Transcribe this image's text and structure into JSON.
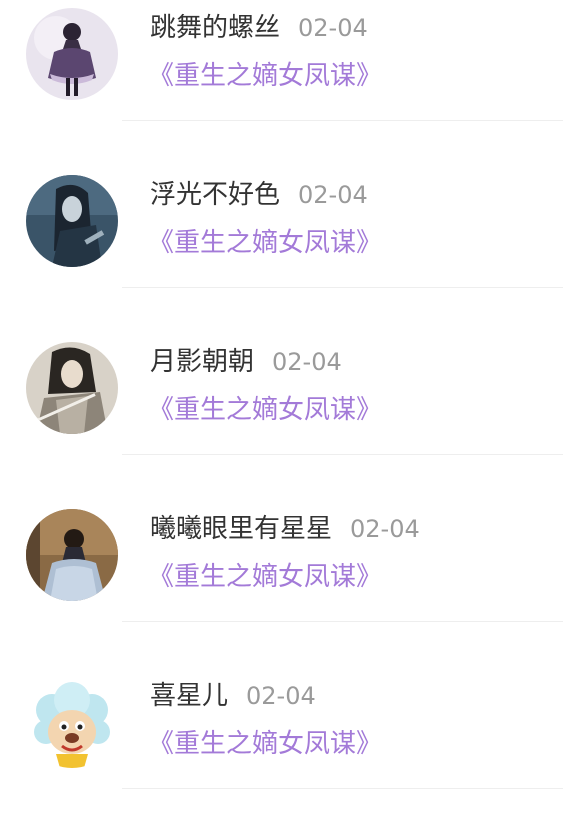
{
  "comments": [
    {
      "user": "跳舞的螺丝",
      "date": "02-04",
      "book": "《重生之嫡女凤谋》",
      "avatar_icon": "gothic-lolita-girl-avatar"
    },
    {
      "user": "浮光不好色",
      "date": "02-04",
      "book": "《重生之嫡女凤谋》",
      "avatar_icon": "dark-haired-character-avatar"
    },
    {
      "user": "月影朝朝",
      "date": "02-04",
      "book": "《重生之嫡女凤谋》",
      "avatar_icon": "ancient-style-swordsman-avatar"
    },
    {
      "user": "曦曦眼里有星星",
      "date": "02-04",
      "book": "《重生之嫡女凤谋》",
      "avatar_icon": "girl-in-gown-avatar"
    },
    {
      "user": "喜星儿",
      "date": "02-04",
      "book": "《重生之嫡女凤谋》",
      "avatar_icon": "cartoon-sheep-avatar"
    }
  ],
  "colors": {
    "name": "#333333",
    "date": "#9a9a9a",
    "book_link": "#a37ad8",
    "divider": "#eeeeee"
  }
}
